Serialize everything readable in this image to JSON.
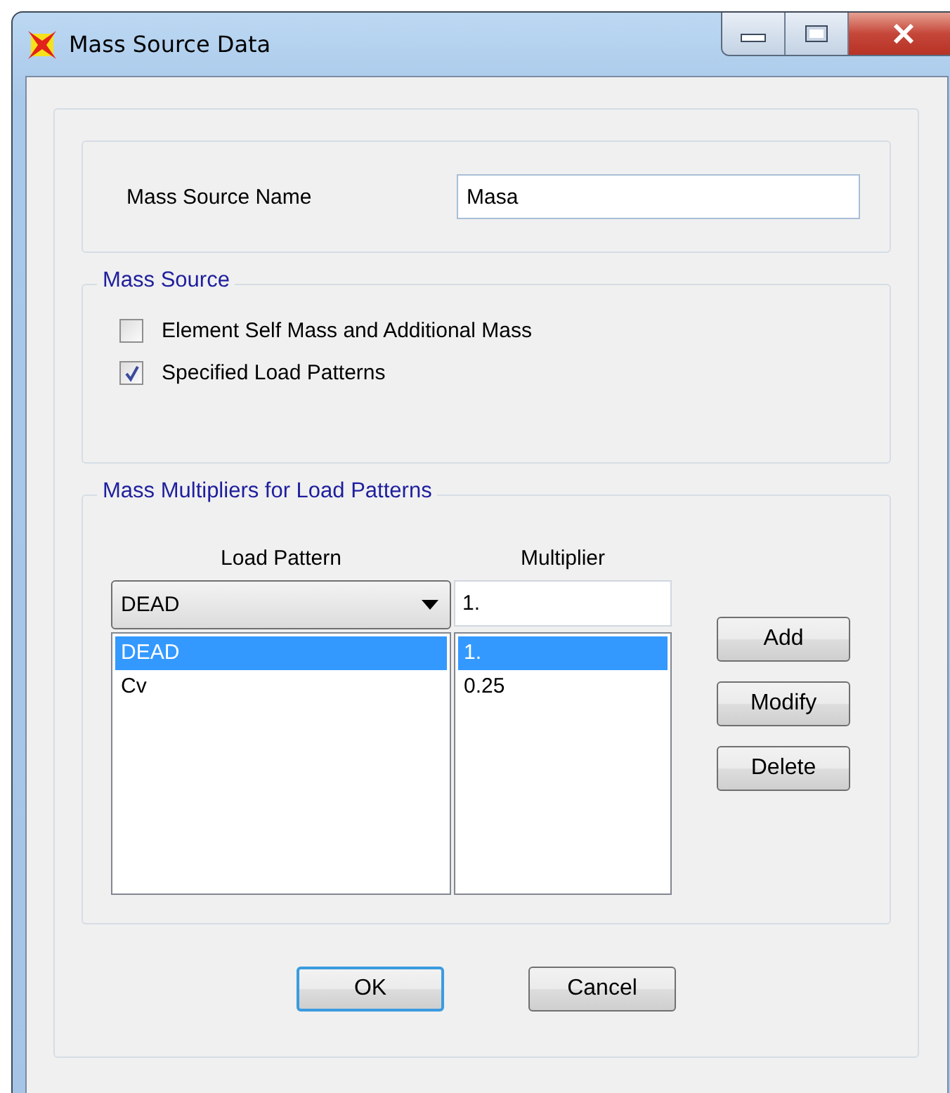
{
  "window": {
    "title": "Mass Source Data"
  },
  "name_field": {
    "label": "Mass Source Name",
    "value": "Masa"
  },
  "mass_source": {
    "title": "Mass Source",
    "options": [
      {
        "label": "Element Self Mass and Additional Mass",
        "checked": false
      },
      {
        "label": "Specified Load Patterns",
        "checked": true
      }
    ]
  },
  "multipliers": {
    "title": "Mass Multipliers for Load Patterns",
    "columns": [
      "Load Pattern",
      "Multiplier"
    ],
    "load_pattern_dropdown": {
      "value": "DEAD"
    },
    "multiplier_input": {
      "value": "1."
    },
    "rows": [
      {
        "load_pattern": "DEAD",
        "multiplier": "1.",
        "selected": true
      },
      {
        "load_pattern": "Cv",
        "multiplier": "0.25",
        "selected": false
      }
    ],
    "buttons": [
      "Add",
      "Modify",
      "Delete"
    ]
  },
  "footer_buttons": [
    {
      "label": "OK",
      "default": true
    },
    {
      "label": "Cancel",
      "default": false
    }
  ]
}
